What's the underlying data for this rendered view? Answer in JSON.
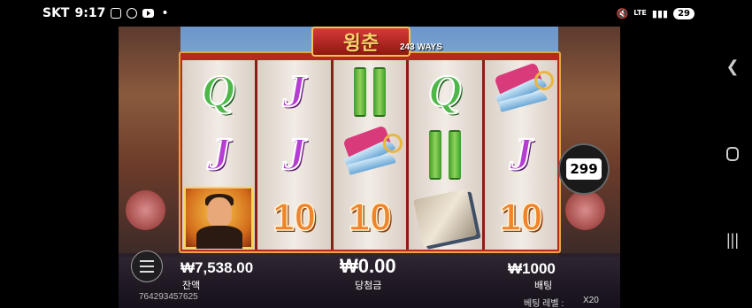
{
  "status_bar": {
    "carrier": "SKT",
    "time": "9:17",
    "icons": [
      "messenger-icon",
      "camera-icon",
      "youtube-icon"
    ],
    "dot": "•",
    "network": "LTE",
    "battery": "29"
  },
  "game": {
    "title": "윙춘",
    "ways": "243 WAYS",
    "counter": "299",
    "reels": [
      [
        "Q",
        "J",
        "hero"
      ],
      [
        "J",
        "J",
        "10"
      ],
      [
        "bamboo",
        "knives",
        "10"
      ],
      [
        "Q",
        "bamboo",
        "scroll"
      ],
      [
        "knives",
        "J",
        "10"
      ]
    ],
    "balance": {
      "value": "₩7,538.00",
      "label": "잔액"
    },
    "win": {
      "value": "₩0.00",
      "label": "당첨금"
    },
    "bet": {
      "value": "₩1000",
      "label": "배팅"
    },
    "session_id": "764293457625",
    "bet_level_label": "베팅 레벨 :",
    "bet_multiplier": "X20"
  },
  "colors": {
    "frame": "#b7281d",
    "gold": "#f2c35a",
    "q_green": "#4db848",
    "j_purple": "#b53ed2",
    "ten_orange": "#f0842a"
  }
}
